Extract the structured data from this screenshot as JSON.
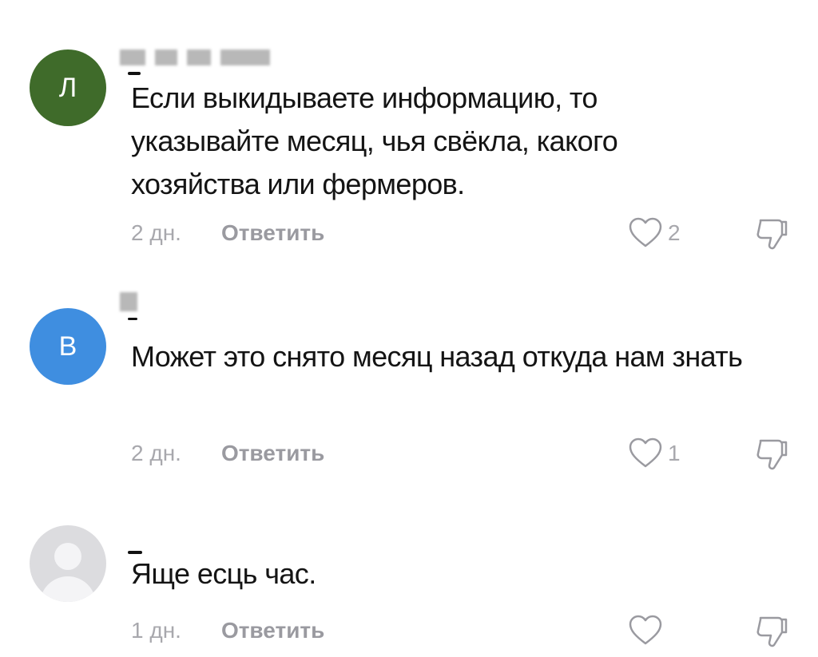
{
  "comments": [
    {
      "avatar_letter": "Л",
      "avatar_color": "#3f6b2a",
      "text": "Если выкидываете информацию, то указывайте месяц, чья свёкла, какого хозяйства или фермеров.",
      "time": "2 дн.",
      "reply_label": "Ответить",
      "likes": "2"
    },
    {
      "avatar_letter": "В",
      "avatar_color": "#3f8ee0",
      "text": "Может это снято месяц назад откуда нам знать",
      "time": "2 дн.",
      "reply_label": "Ответить",
      "likes": "1"
    },
    {
      "avatar_letter": "",
      "avatar_color": "#dcdcdf",
      "text": "Яще есць час.",
      "time": "1 дн.",
      "reply_label": "Ответить",
      "likes": ""
    }
  ],
  "icons": {
    "like": "heart-outline-icon",
    "dislike": "thumbs-down-outline-icon"
  },
  "colors": {
    "icon_gray": "#9a9aa0",
    "meta_gray": "#a8a8ad"
  }
}
